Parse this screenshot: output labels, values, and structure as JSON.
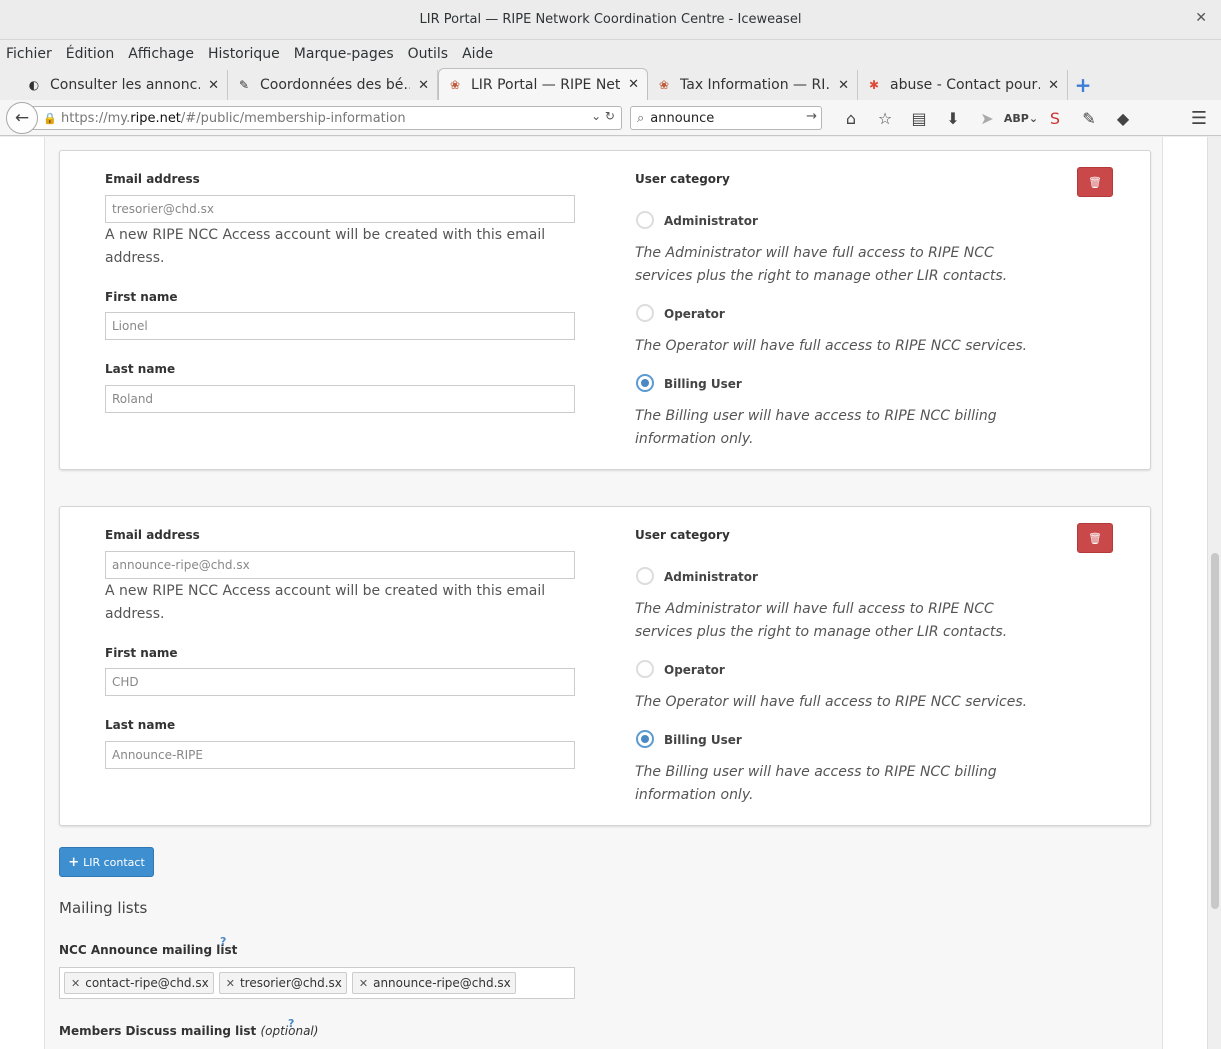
{
  "window": {
    "title": "LIR Portal — RIPE Network Coordination Centre - Iceweasel"
  },
  "menu": [
    "Fichier",
    "Édition",
    "Affichage",
    "Historique",
    "Marque-pages",
    "Outils",
    "Aide"
  ],
  "tabs": [
    {
      "label": "Consulter les annonc…",
      "icon": "site-icon"
    },
    {
      "label": "Coordonnées des bé…",
      "icon": "document-icon"
    },
    {
      "label": "LIR Portal — RIPE Net…",
      "icon": "ripe-icon"
    },
    {
      "label": "Tax Information — RI…",
      "icon": "ripe-icon"
    },
    {
      "label": "abuse - Contact pour…",
      "icon": "google-icon"
    }
  ],
  "url": {
    "proto": "https://my.",
    "host": "ripe.net",
    "path": "/#/public/membership-information"
  },
  "search": {
    "value": "announce"
  },
  "contacts": [
    {
      "email_label": "Email address",
      "email_value": "tresorier@chd.sx",
      "email_help": "A new RIPE NCC Access account will be created with this email address.",
      "first_label": "First name",
      "first_value": "Lionel",
      "last_label": "Last name",
      "last_value": "Roland",
      "category_label": "User category",
      "options": [
        {
          "label": "Administrator",
          "desc": "The Administrator will have full access to RIPE NCC services plus the right to manage other LIR contacts.",
          "checked": false
        },
        {
          "label": "Operator",
          "desc": "The Operator will have full access to RIPE NCC services.",
          "checked": false
        },
        {
          "label": "Billing User",
          "desc": "The Billing user will have access to RIPE NCC billing information only.",
          "checked": true
        }
      ]
    },
    {
      "email_label": "Email address",
      "email_value": "announce-ripe@chd.sx",
      "email_help": "A new RIPE NCC Access account will be created with this email address.",
      "first_label": "First name",
      "first_value": "CHD",
      "last_label": "Last name",
      "last_value": "Announce-RIPE",
      "category_label": "User category",
      "options": [
        {
          "label": "Administrator",
          "desc": "The Administrator will have full access to RIPE NCC services plus the right to manage other LIR contacts.",
          "checked": false
        },
        {
          "label": "Operator",
          "desc": "The Operator will have full access to RIPE NCC services.",
          "checked": false
        },
        {
          "label": "Billing User",
          "desc": "The Billing user will have access to RIPE NCC billing information only.",
          "checked": true
        }
      ]
    }
  ],
  "add_contact_label": "LIR contact",
  "mailing": {
    "title": "Mailing lists",
    "announce_label": "NCC Announce mailing list",
    "help_mark": "?",
    "announce_tags": [
      "contact-ripe@chd.sx",
      "tresorier@chd.sx",
      "announce-ripe@chd.sx"
    ],
    "discuss_label": "Members Discuss mailing list",
    "discuss_optional": "(optional)"
  },
  "colors": {
    "primary": "#3d8fd0",
    "danger": "#c9494a",
    "radio_checked": "#4a89c4"
  }
}
